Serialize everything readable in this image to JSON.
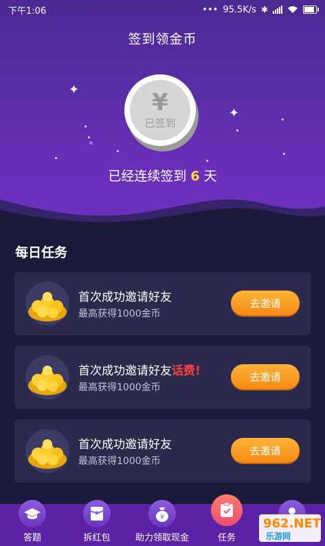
{
  "status": {
    "time": "下午1:06",
    "net_speed": "95.5K/s",
    "dots": "•••"
  },
  "header": {
    "title": "签到领金币"
  },
  "checkin": {
    "coin_symbol": "¥",
    "coin_label": "已签到",
    "streak_prefix": "已经连续签到",
    "streak_days": "6",
    "streak_suffix": "天"
  },
  "daily": {
    "section_title": "每日任务",
    "tasks": [
      {
        "title": "首次成功邀请好友",
        "extra": "",
        "subtitle": "最高获得1000金币",
        "button": "去邀请"
      },
      {
        "title": "首次成功邀请好友",
        "extra": "话费!",
        "subtitle": "最高获得1000金币",
        "button": "去邀请"
      },
      {
        "title": "首次成功邀请好友",
        "extra": "",
        "subtitle": "最高获得1000金币",
        "button": "去邀请"
      }
    ]
  },
  "nav": {
    "items": [
      {
        "label": "答题",
        "icon": "graduation-cap-icon"
      },
      {
        "label": "拆红包",
        "icon": "red-packet-icon"
      },
      {
        "label": "助力领取现金",
        "icon": "money-bag-icon"
      },
      {
        "label": "任务",
        "icon": "clipboard-check-icon"
      },
      {
        "label": "",
        "icon": "user-icon"
      }
    ]
  },
  "watermark": {
    "top": "962.NET",
    "bottom": "乐游网"
  },
  "colors": {
    "accent": "#ffd83c",
    "button": "#f78a14",
    "highlight_red": "#ff3f3f",
    "nav_bg": "#5b22a6"
  }
}
